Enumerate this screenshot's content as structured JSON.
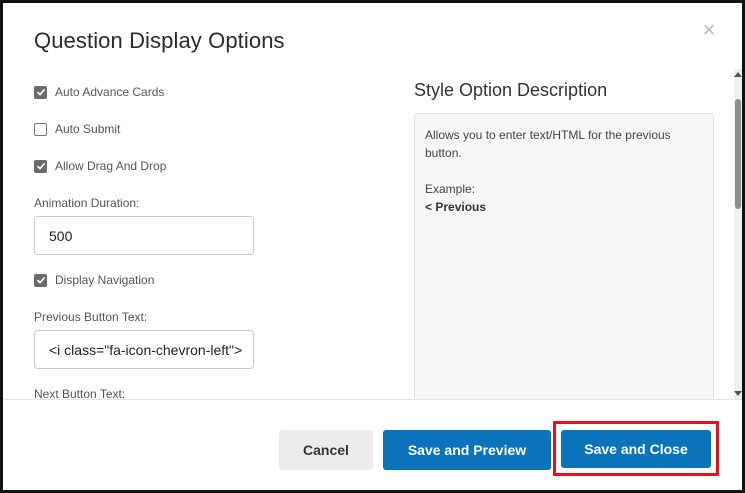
{
  "dialog": {
    "title": "Question Display Options",
    "close_glyph": "×"
  },
  "options": {
    "auto_advance": {
      "label": "Auto Advance Cards",
      "checked": true
    },
    "auto_submit": {
      "label": "Auto Submit",
      "checked": false
    },
    "drag_drop": {
      "label": "Allow Drag And Drop",
      "checked": true
    },
    "animation_duration": {
      "label": "Animation Duration:",
      "value": "500"
    },
    "display_navigation": {
      "label": "Display Navigation",
      "checked": true
    },
    "previous_button_text": {
      "label": "Previous Button Text:",
      "value": "<i class=\"fa-icon-chevron-left\">"
    },
    "next_button_text": {
      "label": "Next Button Text:"
    }
  },
  "description": {
    "title": "Style Option Description",
    "text_line1": "Allows you to enter text/HTML for the previous",
    "text_line2": "button.",
    "example_label": "Example:",
    "example_value": "< Previous"
  },
  "footer": {
    "cancel_label": "Cancel",
    "preview_label": "Save and Preview",
    "save_close_label": "Save and Close"
  },
  "colors": {
    "primary": "#0a73ba",
    "highlight": "#e0121e",
    "cancel_bg": "#ececee"
  },
  "icons": {
    "close": "close-icon",
    "check": "checkmark-icon",
    "scroll_up": "triangle-up-icon",
    "scroll_down": "triangle-down-icon"
  }
}
